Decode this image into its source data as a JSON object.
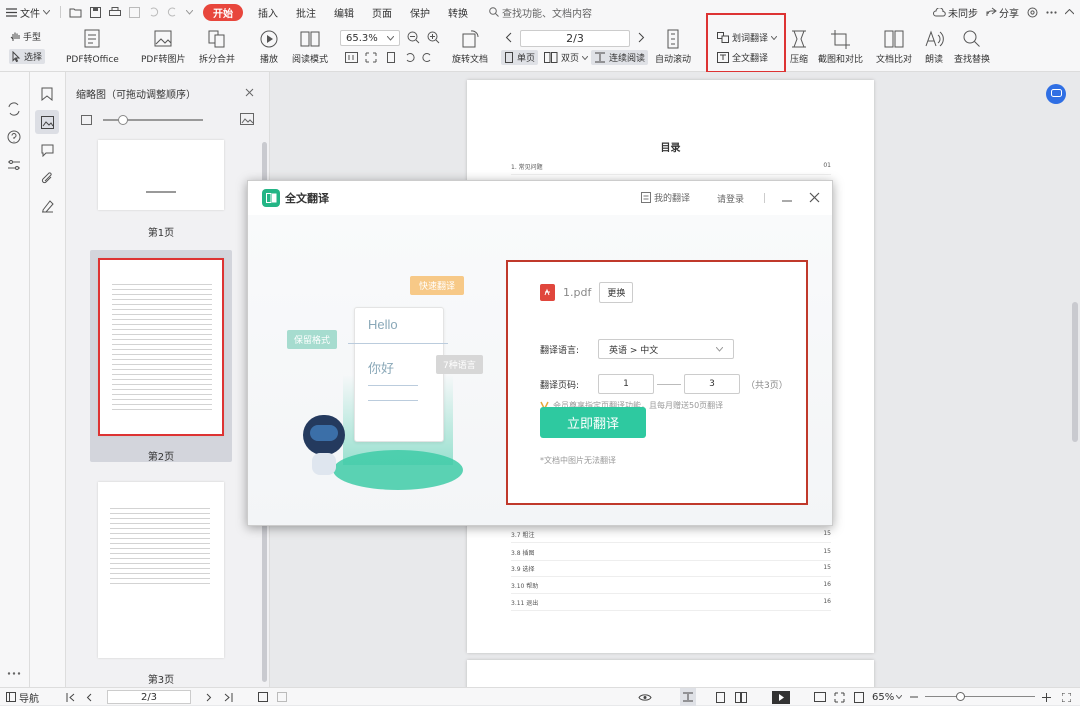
{
  "menubar": {
    "file": "文件",
    "tabs": [
      "开始",
      "插入",
      "批注",
      "编辑",
      "页面",
      "保护",
      "转换"
    ],
    "search_placeholder": "查找功能、文档内容",
    "sync": "未同步",
    "share": "分享"
  },
  "toolbar": {
    "hand": "手型",
    "select": "选择",
    "pdf_to_office": "PDF转Office",
    "pdf_to_image": "PDF转图片",
    "split_merge": "拆分合并",
    "play": "播放",
    "read_mode": "阅读模式",
    "zoom": "65.3%",
    "page": "2/3",
    "rotate": "旋转文档",
    "single": "单页",
    "double": "双页",
    "continuous": "连续阅读",
    "auto_scroll": "自动滚动",
    "word_translate": "划词翻译",
    "full_translate": "全文翻译",
    "compress": "压缩",
    "screenshot_compare": "截图和对比",
    "doc_compare": "文档比对",
    "read_aloud": "朗读",
    "find_replace": "查找替换"
  },
  "thumbnails": {
    "title": "缩略图（可拖动调整顺序）",
    "pages": [
      "第1页",
      "第2页",
      "第3页"
    ]
  },
  "document": {
    "toc_title": "目录",
    "rows_top": [
      {
        "label": "1. 常见问题",
        "num": "01"
      }
    ],
    "rows_bottom": [
      {
        "label": "3.7 粗注",
        "num": "15"
      },
      {
        "label": "3.8 插图",
        "num": "15"
      },
      {
        "label": "3.9 选择",
        "num": "15"
      },
      {
        "label": "3.10 帮助",
        "num": "16"
      },
      {
        "label": "3.11 退出",
        "num": "16"
      }
    ]
  },
  "dialog": {
    "title": "全文翻译",
    "my_translations": "我的翻译",
    "login": "请登录",
    "illustration": {
      "hello": "Hello",
      "nihao": "你好",
      "bubble1": "快速翻译",
      "bubble2": "保留格式",
      "bubble3": "7种语言"
    },
    "file_name": "1.pdf",
    "change": "更换",
    "lang_label": "翻译语言:",
    "lang_value": "英语 > 中文",
    "pages_label": "翻译页码:",
    "page_from": "1",
    "page_to": "3",
    "page_total": "（共3页）",
    "vip_note": "会员尊享指定页翻译功能，且每月赠送50页翻译",
    "translate_button": "立即翻译",
    "footnote": "*文档中图片无法翻译"
  },
  "statusbar": {
    "nav": "导航",
    "page": "2/3",
    "zoom": "65%"
  }
}
